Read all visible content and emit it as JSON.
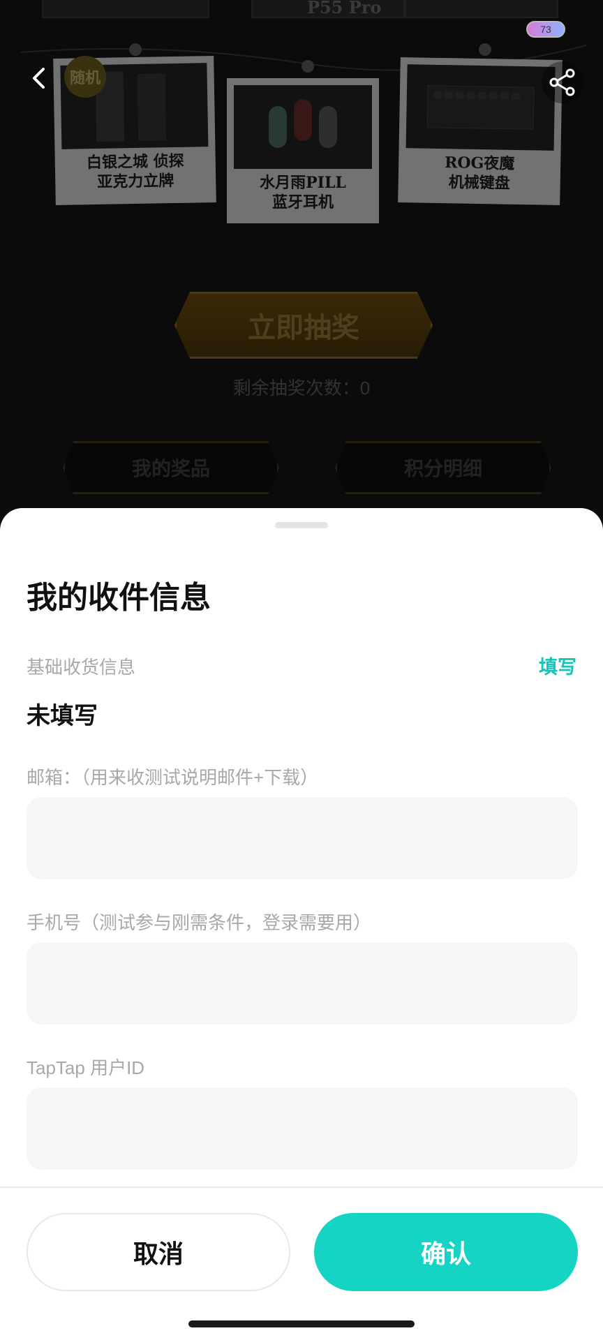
{
  "status_bar": {
    "battery_level": "73"
  },
  "background_page": {
    "top_card_text": "P55 Pro",
    "random_badge": "随机",
    "prizes": [
      {
        "caption_line1": "白银之城 侦探",
        "caption_line2": "亚克力立牌"
      },
      {
        "caption_line1": "水月雨PILL",
        "caption_line2": "蓝牙耳机"
      },
      {
        "caption_line1": "ROG夜魔",
        "caption_line2": "机械键盘"
      }
    ],
    "draw_button": "立即抽奖",
    "draw_count_text": "剩余抽奖次数：0",
    "my_prizes_button": "我的奖品",
    "points_detail_button": "积分明细"
  },
  "sheet": {
    "title": "我的收件信息",
    "section_label": "基础收货信息",
    "fill_link": "填写",
    "address_status": "未填写",
    "fields": {
      "email_label": "邮箱：（用来收测试说明邮件+下载）",
      "email_value": "",
      "phone_label": "手机号（测试参与刚需条件，登录需要用）",
      "phone_value": "",
      "taptap_label": "TapTap 用户ID",
      "taptap_value": ""
    },
    "cancel_label": "取消",
    "confirm_label": "确认"
  },
  "colors": {
    "accent": "#16d4c3",
    "link": "#14c4b8",
    "input_bg": "#f6f6f6"
  },
  "icons": {
    "back": "chevron-left-icon",
    "share": "share-icon"
  }
}
